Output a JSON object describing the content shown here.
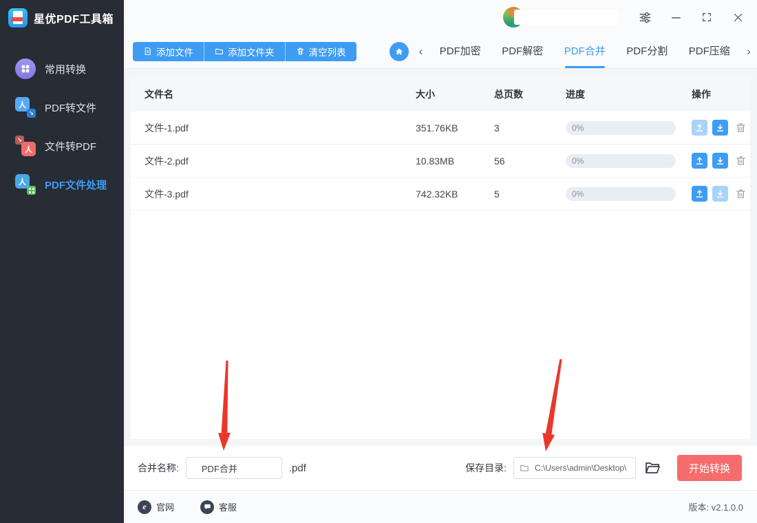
{
  "app": {
    "title": "星优PDF工具箱"
  },
  "sidebar": {
    "items": [
      {
        "label": "常用转换",
        "active": false
      },
      {
        "label": "PDF转文件",
        "active": false
      },
      {
        "label": "文件转PDF",
        "active": false
      },
      {
        "label": "PDF文件处理",
        "active": true
      }
    ]
  },
  "toolbar": {
    "add_file": "添加文件",
    "add_folder": "添加文件夹",
    "clear_list": "清空列表"
  },
  "tabs": {
    "prev_icon": "‹",
    "next_icon": "›",
    "items": [
      {
        "label": "PDF加密",
        "active": false
      },
      {
        "label": "PDF解密",
        "active": false
      },
      {
        "label": "PDF合并",
        "active": true
      },
      {
        "label": "PDF分割",
        "active": false
      },
      {
        "label": "PDF压缩",
        "active": false
      }
    ]
  },
  "table": {
    "headers": [
      "文件名",
      "大小",
      "总页数",
      "进度",
      "操作"
    ],
    "rows": [
      {
        "name": "文件-1.pdf",
        "size": "351.76KB",
        "pages": "3",
        "progress": "0%",
        "up_disabled": true,
        "down_disabled": false
      },
      {
        "name": "文件-2.pdf",
        "size": "10.83MB",
        "pages": "56",
        "progress": "0%",
        "up_disabled": false,
        "down_disabled": false
      },
      {
        "name": "文件-3.pdf",
        "size": "742.32KB",
        "pages": "5",
        "progress": "0%",
        "up_disabled": false,
        "down_disabled": true
      }
    ]
  },
  "bottom": {
    "merge_label": "合并名称:",
    "merge_value": "PDF合并",
    "extension": ".pdf",
    "save_label": "保存目录:",
    "save_path": "C:\\Users\\admin\\Desktop\\",
    "start_label": "开始转换"
  },
  "footer": {
    "website": "官网",
    "website_icon_letter": "e",
    "support": "客服",
    "version": "版本: v2.1.0.0"
  },
  "colors": {
    "primary": "#3e9cf3",
    "primary_disabled": "#a9d3f9",
    "danger": "#f56c6c",
    "sidebar_bg": "#272c35",
    "progress_track": "#e9edf4"
  }
}
